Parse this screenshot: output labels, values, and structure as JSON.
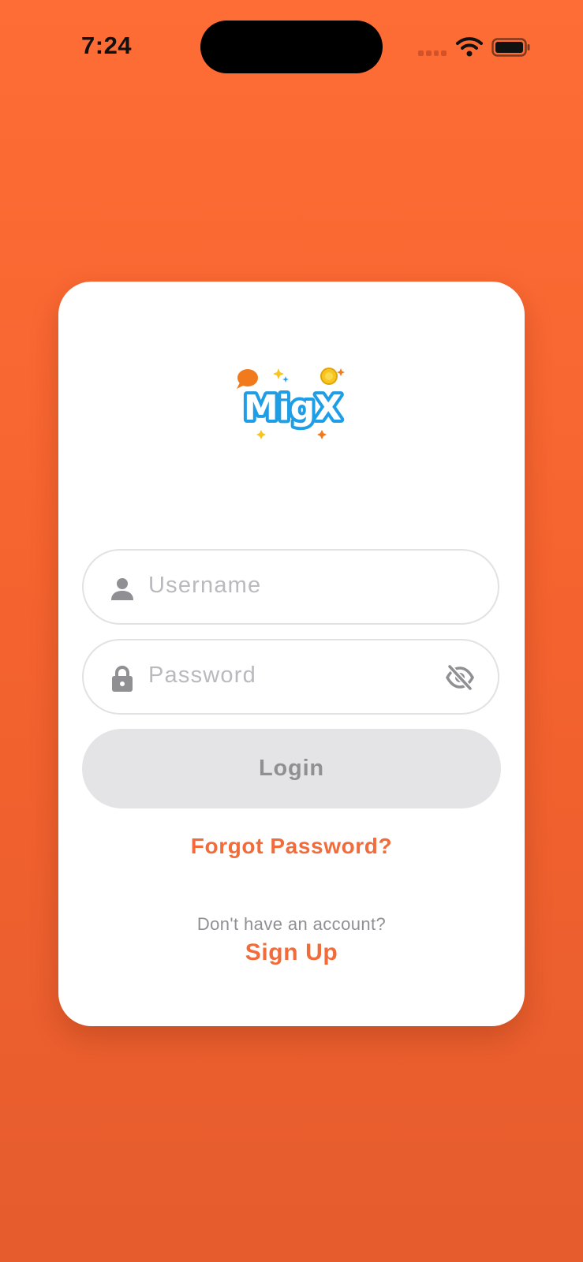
{
  "status_bar": {
    "time": "7:24"
  },
  "logo": {
    "wordmark": "MigX"
  },
  "login_form": {
    "username_placeholder": "Username",
    "password_placeholder": "Password",
    "login_label": "Login",
    "forgot_password_label": "Forgot Password?",
    "signup_prompt": "Don't have an account?",
    "signup_label": "Sign Up"
  },
  "icons": {
    "username": "person-icon",
    "password": "lock-icon",
    "toggle_visibility": "eye-slash-icon"
  },
  "colors": {
    "background": "#f5632f",
    "accent": "#f26b3a",
    "logo_blue": "#1e9ee6",
    "button_disabled_bg": "#e4e3e6",
    "button_disabled_text": "#909094"
  }
}
